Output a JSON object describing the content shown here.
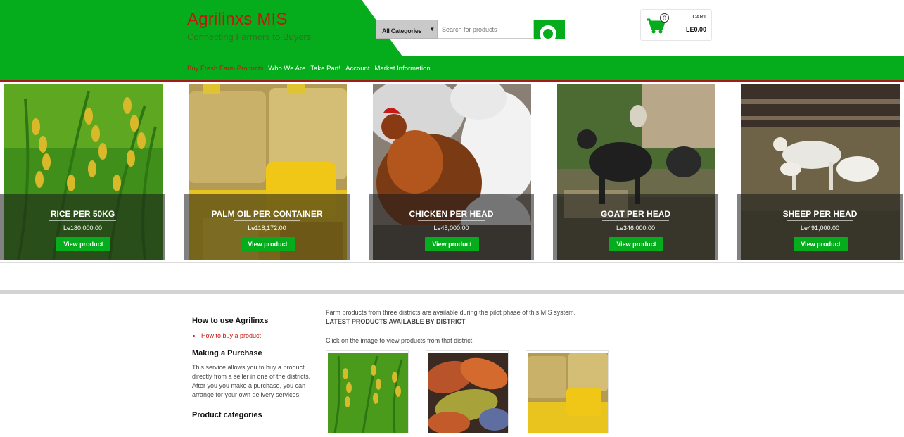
{
  "site": {
    "title": "Agrilinxs MIS",
    "tagline": "Connecting Farmers to Buyers"
  },
  "search": {
    "category": "All Categories",
    "placeholder": "Search for products"
  },
  "cart": {
    "count": "0",
    "label": "CART",
    "total": "LE0.00"
  },
  "nav": {
    "items": [
      {
        "label": "Buy Fresh Farm Products",
        "active": true
      },
      {
        "label": "Who We Are"
      },
      {
        "label": "Take Part!"
      },
      {
        "label": "Account"
      },
      {
        "label": "Market Information"
      }
    ]
  },
  "products": [
    {
      "name": "RICE PER 50KG",
      "price": "Le180,000.00",
      "button": "View product"
    },
    {
      "name": "PALM OIL PER CONTAINER",
      "price": "Le118,172.00",
      "button": "View product"
    },
    {
      "name": "CHICKEN PER HEAD",
      "price": "Le45,000.00",
      "button": "View product"
    },
    {
      "name": "GOAT PER HEAD",
      "price": "Le346,000.00",
      "button": "View product"
    },
    {
      "name": "SHEEP PER HEAD",
      "price": "Le491,000.00",
      "button": "View product"
    }
  ],
  "sidebar": {
    "howto_title": "How to use Agrilinxs",
    "howto_link": "How to buy a product",
    "purchase_title": "Making a Purchase",
    "purchase_text": "This service allows you to buy a product directly from a seller in one of the districts. After you you make a purchase, you can arrange for your own delivery services.",
    "categories_title": "Product categories"
  },
  "main": {
    "intro": "Farm products from three districts are available during the pilot phase of this MIS system.",
    "latest": "LATEST PRODUCTS AVAILABLE BY DISTRICT",
    "click": "Click on the image to view products from that district!"
  },
  "colors": {
    "brand_green": "#05ad1c",
    "brand_red": "#c8140f"
  }
}
